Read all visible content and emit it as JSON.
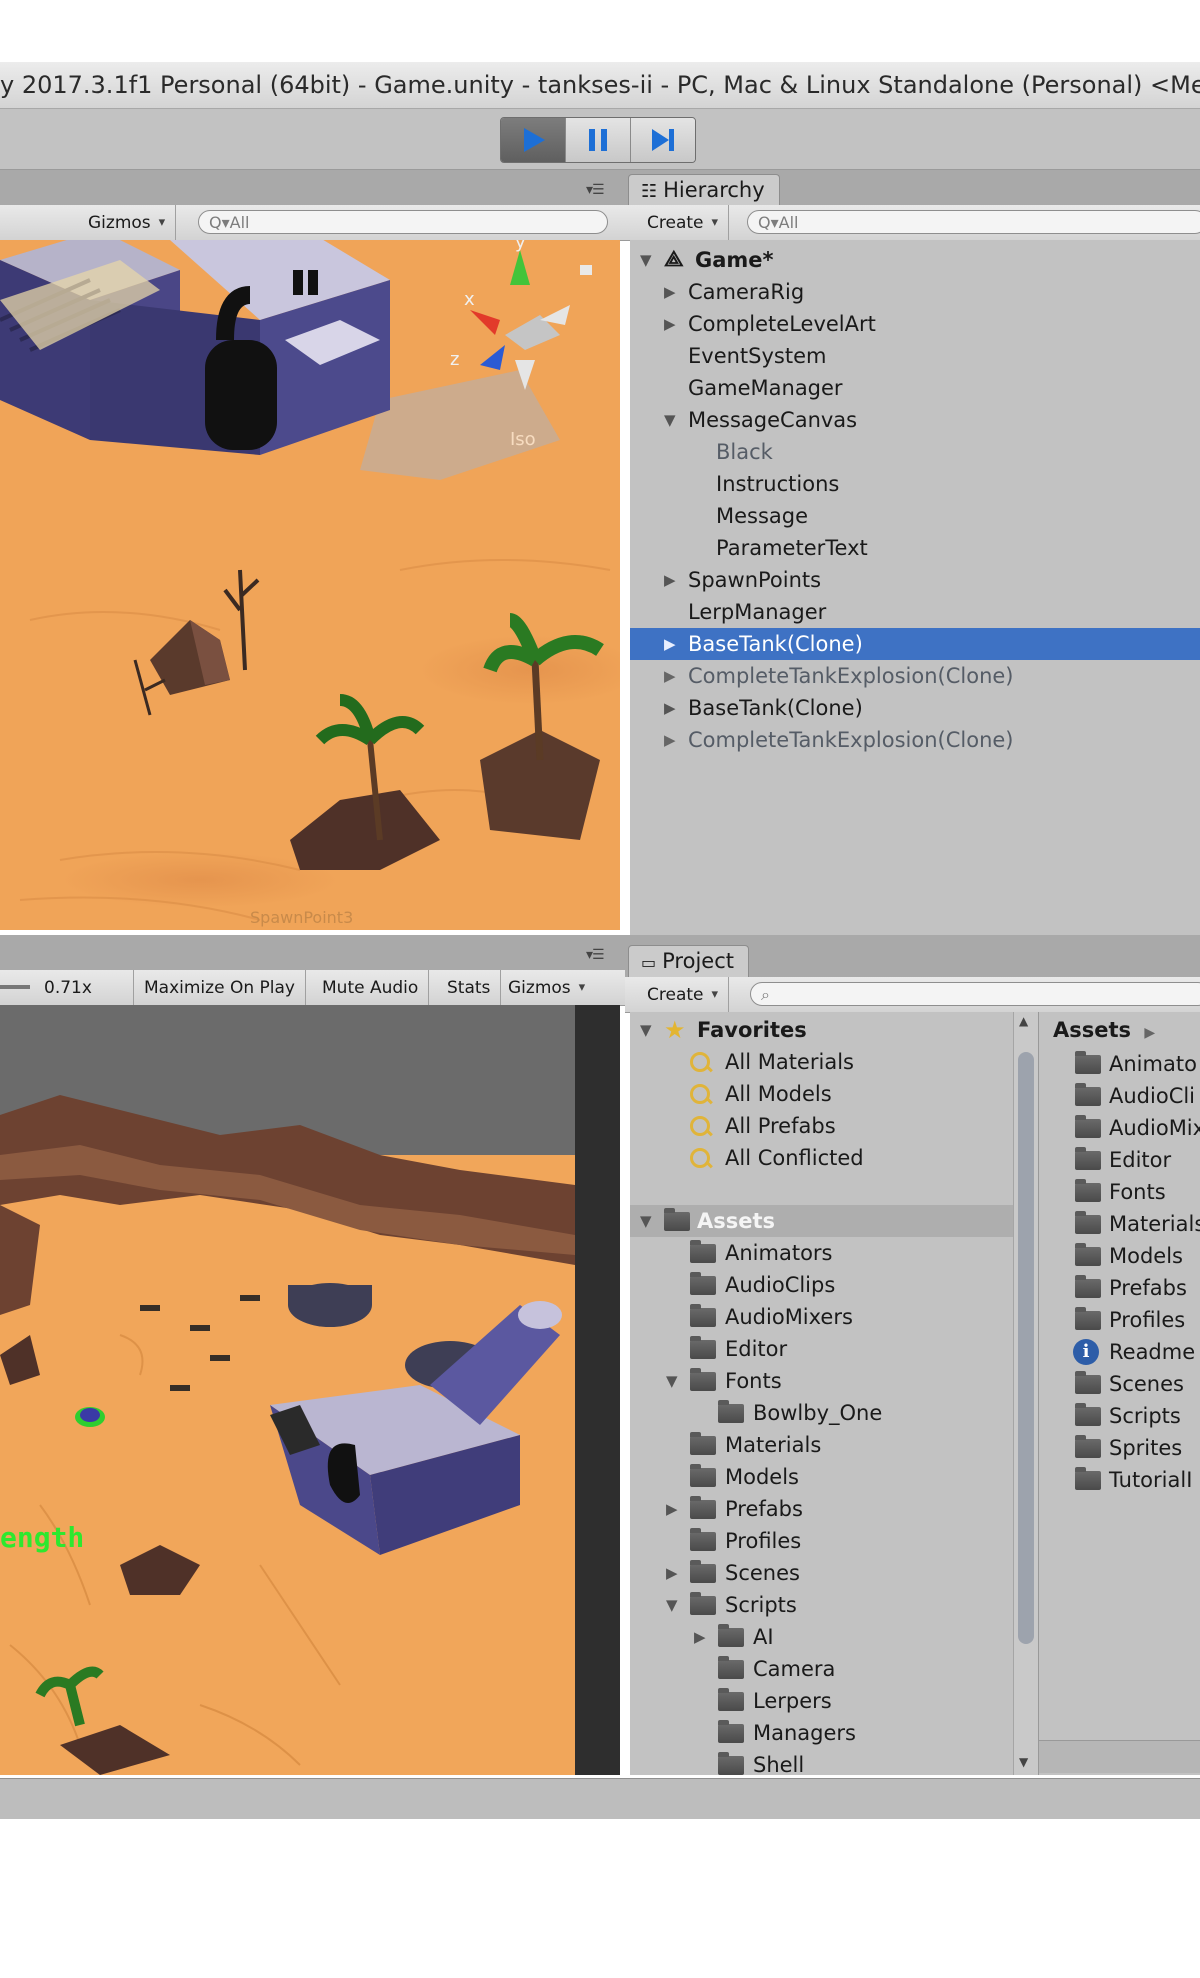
{
  "window": {
    "title": "y 2017.3.1f1 Personal (64bit) - Game.unity - tankses-ii - PC, Mac & Linux Standalone (Personal) <Me"
  },
  "toolbar": {
    "play_icon": "play-icon",
    "pause_icon": "pause-icon",
    "step_icon": "step-icon",
    "accent": "#1d6fd6"
  },
  "scene": {
    "gizmos_label": "Gizmos",
    "search_placeholder": "Q▾All",
    "axis_x": "x",
    "axis_y": "y",
    "axis_z": "z",
    "iso_label": "Iso",
    "spawn_label": "SpawnPoint3"
  },
  "game": {
    "scale_value": "0.71x",
    "maximize_label": "Maximize On Play",
    "mute_label": "Mute Audio",
    "stats_label": "Stats",
    "gizmos_label": "Gizmos",
    "overlay_text": "ength"
  },
  "hierarchy": {
    "tab_label": "Hierarchy",
    "create_label": "Create",
    "search_placeholder": "Q▾All",
    "scene_name": "Game*",
    "items": [
      {
        "label": "CameraRig"
      },
      {
        "label": "CompleteLevelArt"
      },
      {
        "label": "EventSystem"
      },
      {
        "label": "GameManager"
      },
      {
        "label": "MessageCanvas"
      },
      {
        "label": "Black"
      },
      {
        "label": "Instructions"
      },
      {
        "label": "Message"
      },
      {
        "label": "ParameterText"
      },
      {
        "label": "SpawnPoints"
      },
      {
        "label": "LerpManager"
      },
      {
        "label": "BaseTank(Clone)"
      },
      {
        "label": "CompleteTankExplosion(Clone)"
      },
      {
        "label": "BaseTank(Clone)"
      },
      {
        "label": "CompleteTankExplosion(Clone)"
      }
    ],
    "selected_color": "#3e72c4"
  },
  "project": {
    "tab_label": "Project",
    "create_label": "Create",
    "favorites_label": "Favorites",
    "favorites": [
      "All Materials",
      "All Models",
      "All Prefabs",
      "All Conflicted"
    ],
    "assets_label": "Assets",
    "tree": [
      "Animators",
      "AudioClips",
      "AudioMixers",
      "Editor",
      "Fonts",
      "Bowlby_One",
      "Materials",
      "Models",
      "Prefabs",
      "Profiles",
      "Scenes",
      "Scripts",
      "AI",
      "Camera",
      "Lerpers",
      "Managers",
      "Shell"
    ],
    "right_header": "Assets",
    "right_items": [
      "Animato",
      "AudioCli",
      "AudioMix",
      "Editor",
      "Fonts",
      "Materials",
      "Models",
      "Prefabs",
      "Profiles",
      "Readme",
      "Scenes",
      "Scripts",
      "Sprites",
      "TutorialI"
    ]
  }
}
